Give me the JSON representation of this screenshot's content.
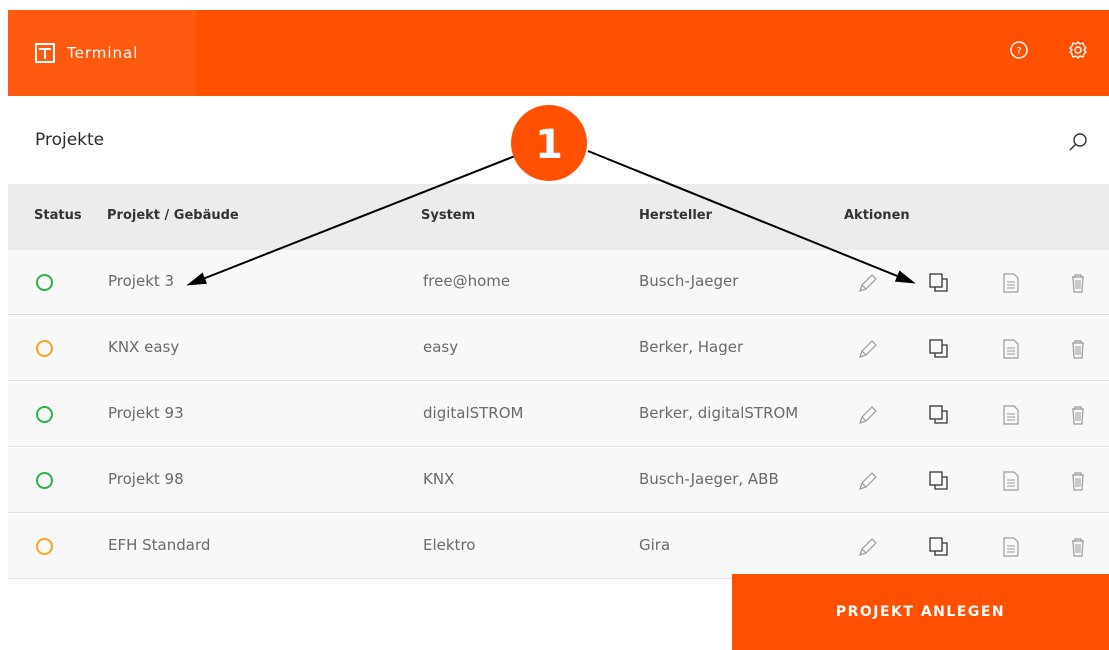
{
  "app": {
    "name": "Terminal"
  },
  "header": {
    "help_icon": "help-circle-icon",
    "settings_icon": "gear-icon"
  },
  "section": {
    "title": "Projekte"
  },
  "table": {
    "columns": [
      "Status",
      "Projekt / Gebäude",
      "System",
      "Hersteller",
      "Aktionen"
    ],
    "rows": [
      {
        "status": "green",
        "project": "Projekt 3",
        "system": "free@home",
        "manufacturer": "Busch-Jaeger"
      },
      {
        "status": "orange",
        "project": "KNX easy",
        "system": "easy",
        "manufacturer": "Berker, Hager"
      },
      {
        "status": "green",
        "project": "Projekt 93",
        "system": "digitalSTROM",
        "manufacturer": "Berker, digitalSTROM"
      },
      {
        "status": "green",
        "project": "Projekt 98",
        "system": "KNX",
        "manufacturer": "Busch-Jaeger, ABB"
      },
      {
        "status": "orange",
        "project": "EFH Standard",
        "system": "Elektro",
        "manufacturer": "Gira"
      }
    ],
    "actions": [
      "edit-icon",
      "duplicate-icon",
      "document-icon",
      "trash-icon"
    ]
  },
  "buttons": {
    "create": "PROJEKT ANLEGEN"
  },
  "annotation": {
    "badge": "1"
  },
  "colors": {
    "accent": "#ff4f00",
    "status_green": "#2cb34a",
    "status_orange": "#f5a623"
  }
}
